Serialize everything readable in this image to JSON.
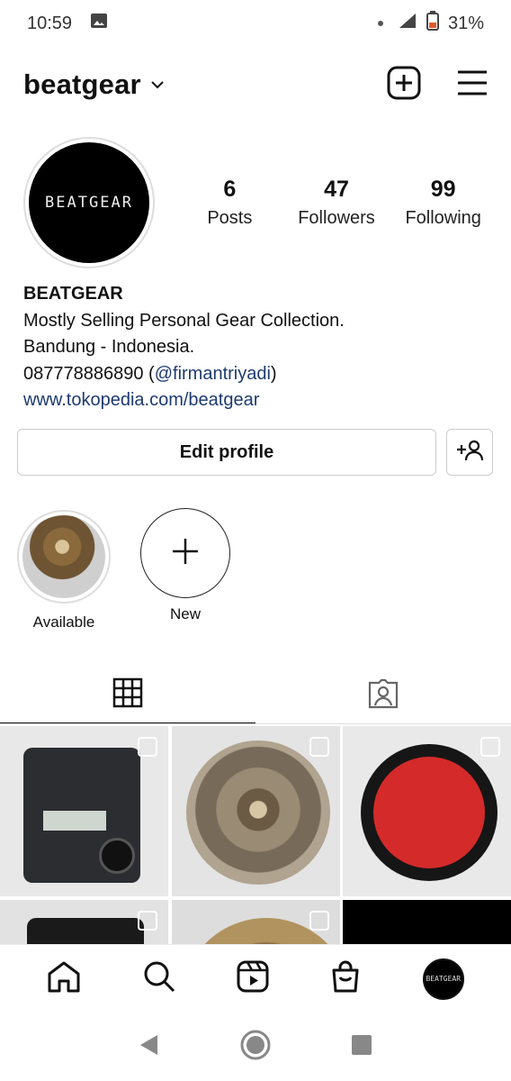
{
  "status_bar": {
    "time": "10:59",
    "battery": "31%"
  },
  "header": {
    "username": "beatgear"
  },
  "profile": {
    "avatar_text": "BEATGEAR",
    "stats": [
      {
        "value": "6",
        "label": "Posts"
      },
      {
        "value": "47",
        "label": "Followers"
      },
      {
        "value": "99",
        "label": "Following"
      }
    ],
    "bio": {
      "name": "BEATGEAR",
      "line1": "Mostly Selling Personal Gear Collection.",
      "line2": "Bandung - Indonesia.",
      "phone": "087778886890 (",
      "mention": "@firmantriyadi",
      "phone_close": ")",
      "website": "www.tokopedia.com/beatgear"
    }
  },
  "buttons": {
    "edit_profile": "Edit profile"
  },
  "highlights": [
    {
      "label": "Available"
    },
    {
      "label": "New"
    }
  ],
  "nav": {
    "avatar_text": "BEATGEAR"
  }
}
